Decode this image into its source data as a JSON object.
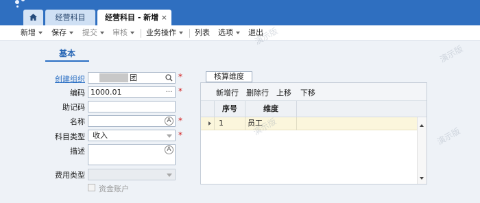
{
  "tabs": {
    "home_icon": "home-icon",
    "first_label": "经营科目",
    "active_label": "经营科目 - 新增",
    "close_glyph": "×"
  },
  "toolbar": {
    "new": "新增",
    "save": "保存",
    "submit": "提交",
    "audit": "审核",
    "business_ops": "业务操作",
    "list": "列表",
    "options": "选项",
    "exit": "退出"
  },
  "form": {
    "section_tab": "基本",
    "required_mark": "*",
    "org": {
      "label": "创建组织",
      "value": "团"
    },
    "code": {
      "label": "编码",
      "value": "1000.01",
      "button": "···"
    },
    "mnemonic": {
      "label": "助记码",
      "value": ""
    },
    "name": {
      "label": "名称",
      "value": "",
      "button": "A"
    },
    "type": {
      "label": "科目类型",
      "value": "收入"
    },
    "description": {
      "label": "描述",
      "value": "",
      "button": "A"
    },
    "expense_type": {
      "label": "费用类型",
      "value": ""
    },
    "fund_account": {
      "label": "资金账户",
      "checked": false
    }
  },
  "dimension": {
    "tab": "核算维度",
    "tools": [
      "新增行",
      "删除行",
      "上移",
      "下移"
    ],
    "columns": [
      "序号",
      "维度"
    ],
    "rows": [
      {
        "no": "1",
        "dimension": "员工"
      }
    ]
  },
  "watermark": "演示版",
  "colors": {
    "topbar": "#2f6fc0",
    "accent": "#2a6fc4",
    "required": "#d21818",
    "selected_row": "#fbf6dc"
  }
}
